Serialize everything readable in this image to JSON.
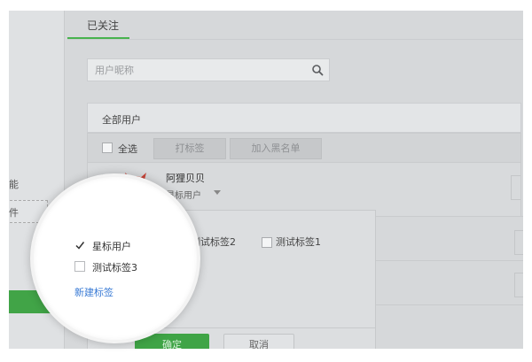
{
  "tabs": {
    "followed": "已关注"
  },
  "sidebar": {
    "text_1": "能",
    "text_2": "件"
  },
  "search": {
    "placeholder": "用户昵称",
    "value": ""
  },
  "panel": {
    "title": "全部用户",
    "select_all": "全选",
    "tag_button": "打标签",
    "blacklist_button": "加入黑名单"
  },
  "user": {
    "name": "阿狸贝贝",
    "tag": "星标用户"
  },
  "tag_dropdown": {
    "options": [
      {
        "label": "星标用户",
        "checked": true
      },
      {
        "label": "测试标签2",
        "checked": false
      },
      {
        "label": "测试标签1",
        "checked": false
      },
      {
        "label": "测试标签3",
        "checked": false
      }
    ],
    "new_tag": "新建标签",
    "confirm": "确定",
    "cancel": "取消"
  },
  "colors": {
    "accent_green": "#41a447",
    "link_blue": "#3a7bd5"
  },
  "icons": {
    "search": "search-icon",
    "check": "check-icon",
    "dropdown_arrow": "triangle-down-icon"
  }
}
